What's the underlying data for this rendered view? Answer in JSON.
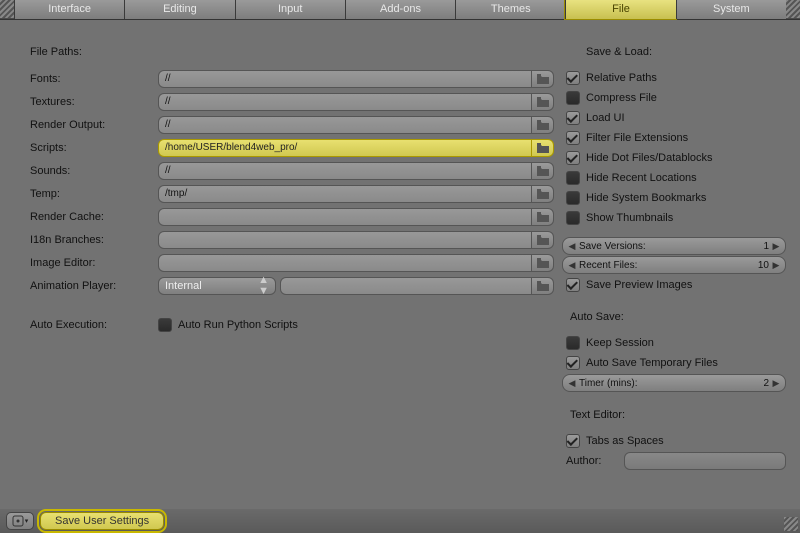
{
  "tabs": [
    "Interface",
    "Editing",
    "Input",
    "Add-ons",
    "Themes",
    "File",
    "System"
  ],
  "active_tab": "File",
  "file_paths": {
    "title": "File Paths:",
    "rows": [
      {
        "label": "Fonts:",
        "value": "//",
        "hl": false
      },
      {
        "label": "Textures:",
        "value": "//",
        "hl": false
      },
      {
        "label": "Render Output:",
        "value": "//",
        "hl": false
      },
      {
        "label": "Scripts:",
        "value": "/home/USER/blend4web_pro/",
        "hl": true
      },
      {
        "label": "Sounds:",
        "value": "//",
        "hl": false
      },
      {
        "label": "Temp:",
        "value": "/tmp/",
        "hl": false
      },
      {
        "label": "Render Cache:",
        "value": "",
        "hl": false
      },
      {
        "label": "I18n Branches:",
        "value": "",
        "hl": false
      },
      {
        "label": "Image Editor:",
        "value": "",
        "hl": false
      }
    ],
    "anim_label": "Animation Player:",
    "anim_select": "Internal",
    "anim_value": ""
  },
  "auto_exec": {
    "label": "Auto Execution:",
    "opt": "Auto Run Python Scripts",
    "checked": false
  },
  "save_load": {
    "title": "Save & Load:",
    "opts": [
      {
        "label": "Relative Paths",
        "checked": true
      },
      {
        "label": "Compress File",
        "checked": false
      },
      {
        "label": "Load UI",
        "checked": true
      },
      {
        "label": "Filter File Extensions",
        "checked": true
      },
      {
        "label": "Hide Dot Files/Datablocks",
        "checked": true
      },
      {
        "label": "Hide Recent Locations",
        "checked": false
      },
      {
        "label": "Hide System Bookmarks",
        "checked": false
      },
      {
        "label": "Show Thumbnails",
        "checked": false
      }
    ],
    "save_versions": {
      "label": "Save Versions:",
      "value": "1"
    },
    "recent_files": {
      "label": "Recent Files:",
      "value": "10"
    },
    "save_preview": {
      "label": "Save Preview Images",
      "checked": true
    }
  },
  "auto_save": {
    "title": "Auto Save:",
    "keep_session": {
      "label": "Keep Session",
      "checked": false
    },
    "auto_save_tmp": {
      "label": "Auto Save Temporary Files",
      "checked": true
    },
    "timer": {
      "label": "Timer (mins):",
      "value": "2"
    }
  },
  "text_editor": {
    "title": "Text Editor:",
    "tabs_spaces": {
      "label": "Tabs as Spaces",
      "checked": true
    },
    "author_label": "Author:"
  },
  "footer": {
    "save_user": "Save User Settings"
  }
}
